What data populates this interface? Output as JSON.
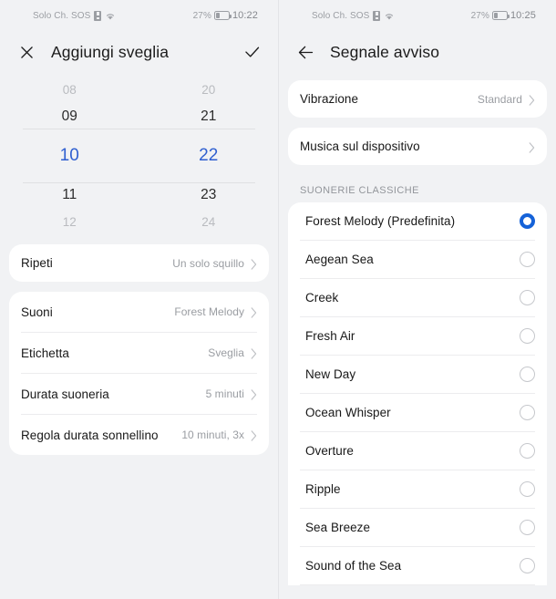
{
  "statusbar": {
    "carrier": "Solo Ch. SOS",
    "battery_pct": "27%",
    "time_left": "10:22",
    "time_right": "10:25",
    "sim_icon": "sim-card-icon",
    "wifi_icon": "wifi-icon",
    "battery_icon": "battery-icon"
  },
  "left": {
    "appbar": {
      "close_icon": "close-icon",
      "title": "Aggiungi sveglia",
      "confirm_icon": "check-icon"
    },
    "picker": {
      "hours": [
        "08",
        "09",
        "10",
        "11",
        "12"
      ],
      "minutes": [
        "20",
        "21",
        "22",
        "23",
        "24"
      ],
      "selected_hour": "10",
      "selected_minute": "22",
      "accent": "#2f5fd0"
    },
    "repeat_card": [
      {
        "label": "Ripeti",
        "value": "Un solo squillo",
        "chevron": "chevron-right-icon"
      }
    ],
    "options_card": [
      {
        "label": "Suoni",
        "value": "Forest Melody",
        "chevron": "chevron-right-icon"
      },
      {
        "label": "Etichetta",
        "value": "Sveglia",
        "chevron": "chevron-right-icon"
      },
      {
        "label": "Durata suoneria",
        "value": "5 minuti",
        "chevron": "chevron-right-icon"
      },
      {
        "label": "Regola durata sonnellino",
        "value": "10 minuti, 3x",
        "chevron": "chevron-right-icon"
      }
    ]
  },
  "right": {
    "appbar": {
      "back_icon": "arrow-left-icon",
      "title": "Segnale avviso"
    },
    "vibration_card": [
      {
        "label": "Vibrazione",
        "value": "Standard",
        "chevron": "chevron-right-icon"
      }
    ],
    "music_card": [
      {
        "label": "Musica sul dispositivo",
        "value": "",
        "chevron": "chevron-right-icon"
      }
    ],
    "section_title": "SUONERIE CLASSICHE",
    "selected_ringtone": "Forest Melody (Predefinita)",
    "accent": "#1562d8",
    "ringtones": [
      {
        "label": "Forest Melody (Predefinita)",
        "selected": true
      },
      {
        "label": "Aegean Sea",
        "selected": false
      },
      {
        "label": "Creek",
        "selected": false
      },
      {
        "label": "Fresh Air",
        "selected": false
      },
      {
        "label": "New Day",
        "selected": false
      },
      {
        "label": "Ocean Whisper",
        "selected": false
      },
      {
        "label": "Overture",
        "selected": false
      },
      {
        "label": "Ripple",
        "selected": false
      },
      {
        "label": "Sea Breeze",
        "selected": false
      },
      {
        "label": "Sound of the Sea",
        "selected": false
      }
    ]
  }
}
